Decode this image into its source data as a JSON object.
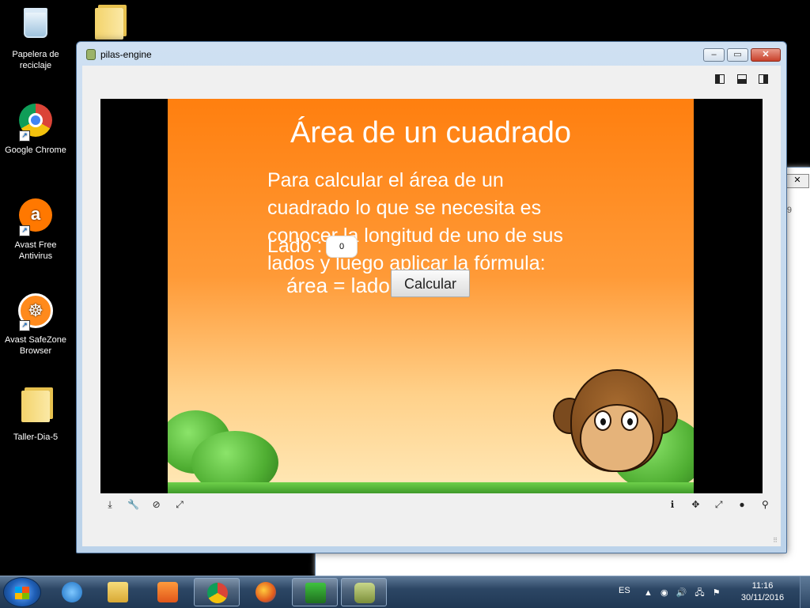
{
  "desktop": {
    "icons": [
      {
        "label": "Papelera de reciclaje",
        "icon": "recycle-bin-icon"
      },
      {
        "label": "Google Chrome",
        "icon": "chrome-icon"
      },
      {
        "label": "Avast Free Antivirus",
        "icon": "avast-icon"
      },
      {
        "label": "Avast SafeZone Browser",
        "icon": "safezone-icon"
      },
      {
        "label": "Taller-Dia-5",
        "icon": "folder-icon"
      }
    ]
  },
  "background_window": {
    "close_glyph": "✕",
    "partial_text": "9"
  },
  "window": {
    "title": "pilas-engine",
    "controls": {
      "minimize": "–",
      "maximize": "▭",
      "close": "✕"
    },
    "layout_buttons": [
      "layout-left-icon",
      "layout-bottom-icon",
      "layout-right-icon"
    ]
  },
  "game": {
    "title": "Área de un cuadrado",
    "text_lines": [
      "Para calcular el área de un",
      "cuadrado lo que se necesita es",
      "conocer la longitud de uno de sus",
      "lados y luego aplicar la fórmula:"
    ],
    "formula": "área = lado",
    "lado_label": "Lado :",
    "input_value": "0",
    "button_label": "Calcular"
  },
  "toolbar": {
    "left": [
      {
        "name": "download-icon",
        "glyph": "⤓"
      },
      {
        "name": "wrench-icon",
        "glyph": "🔧"
      },
      {
        "name": "no-entry-icon",
        "glyph": "⊘"
      },
      {
        "name": "expand-icon",
        "glyph": "⤢"
      }
    ],
    "right": [
      {
        "name": "info-icon",
        "glyph": "ℹ"
      },
      {
        "name": "move-icon",
        "glyph": "✥"
      },
      {
        "name": "resize-icon",
        "glyph": "⤢"
      },
      {
        "name": "globe-icon",
        "glyph": "●"
      },
      {
        "name": "location-icon",
        "glyph": "⚲"
      }
    ]
  },
  "taskbar": {
    "language": "ES",
    "tray_glyphs": [
      "▲",
      "◉",
      "🔊",
      "🖧",
      "⚑"
    ],
    "clock": {
      "time": "11:16",
      "date": "30/11/2016"
    },
    "apps": [
      "internet-explorer-icon",
      "file-explorer-icon",
      "media-player-icon",
      "chrome-icon",
      "firefox-icon",
      "app-tool-icon",
      "pilas-engine-icon"
    ]
  },
  "colors": {
    "canvas_top": "#ff7f0f",
    "canvas_bottom": "#ffe9b8",
    "titlebar": "#cfe0f2",
    "taskbar": "#2c4664"
  }
}
